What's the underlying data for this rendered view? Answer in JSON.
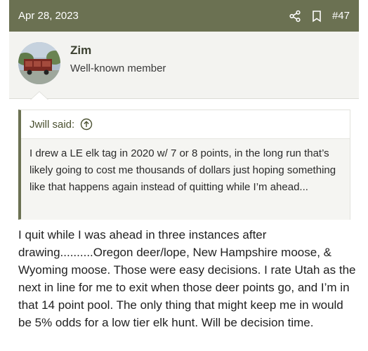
{
  "header": {
    "date": "Apr 28, 2023",
    "post_number": "#47",
    "colors": {
      "bar": "#6b7152",
      "text": "#ffffff"
    },
    "icons": [
      "share-icon",
      "bookmark-icon"
    ]
  },
  "user": {
    "name": "Zim",
    "title": "Well-known member",
    "avatar_icon": "avatar-truck-photo"
  },
  "quote": {
    "author_line": "Jwill said:",
    "icon": "arrow-up-circle-icon",
    "text": "I drew a LE elk tag in 2020 w/ 7 or 8 points, in the long run that’s likely going to cost me thousands of dollars just hoping something like that happens again instead of quitting while I’m ahead..."
  },
  "post": {
    "text": "I quit while I was ahead in three instances after drawing..........Oregon deer/lope, New Hampshire moose, & Wyoming moose. Those were easy decisions. I rate Utah as the next in line for me to exit when those deer points go, and I’m in that 14 point pool. The only thing that might keep me in would be 5% odds for a low tier elk hunt. Will be decision time."
  }
}
